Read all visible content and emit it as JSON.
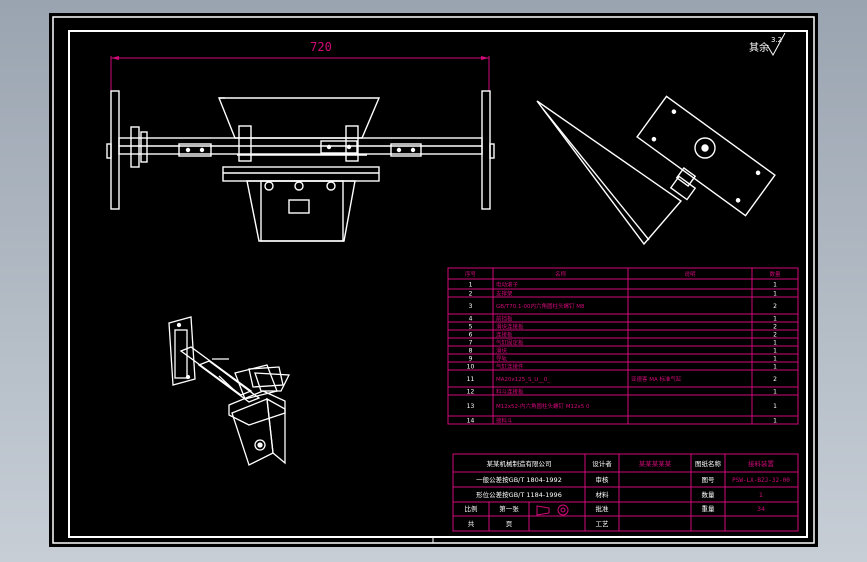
{
  "dimension": {
    "overall_width": "720"
  },
  "roughness": {
    "label": "其余",
    "value": "3.2"
  },
  "parts_list": {
    "headers": [
      "序号",
      "名称",
      "说明",
      "数量"
    ],
    "rows": [
      {
        "no": "1",
        "name": "电动滚子",
        "note": "",
        "qty": "1"
      },
      {
        "no": "2",
        "name": "支撑架",
        "note": "",
        "qty": "1"
      },
      {
        "no": "3",
        "name": "GB/T70.1-00内六角圆柱头螺钉 M8",
        "note": "",
        "qty": "2"
      },
      {
        "no": "4",
        "name": "前挡板",
        "note": "",
        "qty": "1"
      },
      {
        "no": "5",
        "name": "滑块连接板",
        "note": "",
        "qty": "2"
      },
      {
        "no": "6",
        "name": "连接板",
        "note": "",
        "qty": "2"
      },
      {
        "no": "7",
        "name": "气缸固定板",
        "note": "",
        "qty": "1"
      },
      {
        "no": "8",
        "name": "滑块",
        "note": "",
        "qty": "1"
      },
      {
        "no": "9",
        "name": "导轨",
        "note": "",
        "qty": "1"
      },
      {
        "no": "10",
        "name": "气缸连接件",
        "note": "",
        "qty": "1"
      },
      {
        "no": "11",
        "name": "MA20x125_S_U__0_",
        "note": "亚德客 MA 标准气缸",
        "qty": "2"
      },
      {
        "no": "12",
        "name": "料斗连接板",
        "note": "",
        "qty": "1"
      },
      {
        "no": "13",
        "name": "M12x52-内六角圆柱头螺钉 M12x5 0",
        "note": "",
        "qty": "1"
      },
      {
        "no": "14",
        "name": "接料斗",
        "note": "",
        "qty": "1"
      }
    ]
  },
  "title_block": {
    "company": "某某机械制造有限公司",
    "line2": "一般公差按GB/T 1804-1992",
    "line3": "形位公差按GB/T 1184-1996",
    "designed_label": "设计者",
    "designer": "某某某某某",
    "drawing_title_label": "图纸名称",
    "drawing_title": "接料装置",
    "number_label": "图号",
    "drawing_number": "PSW-LX-BZJ-32-00",
    "checked_label": "审核",
    "material_label": "材料",
    "approved_label": "批准",
    "quantity_label": "数量",
    "quantity_value": "1",
    "scale_label": "比例",
    "sheet_label": "第一张",
    "process_label": "工艺",
    "weight_label": "重量",
    "weight_value": "34",
    "sheet_total_label": "共",
    "page_label": "页"
  }
}
